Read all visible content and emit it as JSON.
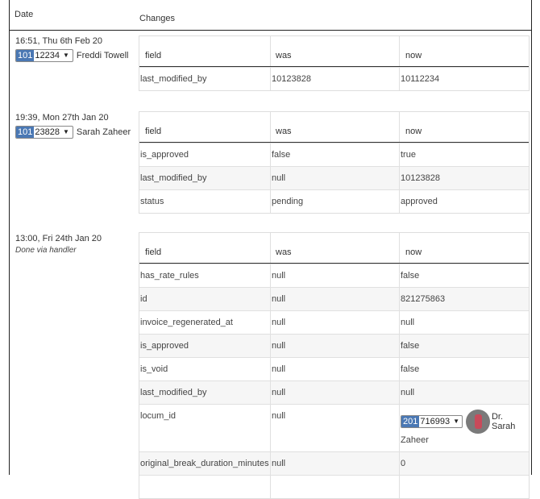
{
  "header": {
    "date_label": "Date",
    "changes_label": "Changes"
  },
  "table_columns": {
    "field": "field",
    "was": "was",
    "now": "now"
  },
  "entries": [
    {
      "timestamp": "16:51, Thu 6th Feb 20",
      "user": {
        "id_prefix": "101",
        "id_rest": "12234",
        "name": "Freddi Towell"
      },
      "rows": [
        {
          "field": "last_modified_by",
          "was": "10123828",
          "now": "10112234"
        }
      ]
    },
    {
      "timestamp": "19:39, Mon 27th Jan 20",
      "user": {
        "id_prefix": "101",
        "id_rest": "23828",
        "name": "Sarah Zaheer"
      },
      "rows": [
        {
          "field": "is_approved",
          "was": "false",
          "now": "true"
        },
        {
          "field": "last_modified_by",
          "was": "null",
          "now": "10123828"
        },
        {
          "field": "status",
          "was": "pending",
          "now": "approved"
        }
      ]
    },
    {
      "timestamp": "13:00, Fri 24th Jan 20",
      "note": "Done via handler",
      "rows": [
        {
          "field": "has_rate_rules",
          "was": "null",
          "now": "false"
        },
        {
          "field": "id",
          "was": "null",
          "now": "821275863"
        },
        {
          "field": "invoice_regenerated_at",
          "was": "null",
          "now": "null"
        },
        {
          "field": "is_approved",
          "was": "null",
          "now": "false"
        },
        {
          "field": "is_void",
          "was": "null",
          "now": "false"
        },
        {
          "field": "last_modified_by",
          "was": "null",
          "now": "null"
        },
        {
          "field": "locum_id",
          "was": "null",
          "now_user": {
            "id_prefix": "201",
            "id_rest": "716993",
            "name_line1": "Dr. Sarah",
            "name_line2": "Zaheer"
          }
        },
        {
          "field": "original_break_duration_minutes",
          "was": "null",
          "now": "0"
        }
      ]
    }
  ]
}
